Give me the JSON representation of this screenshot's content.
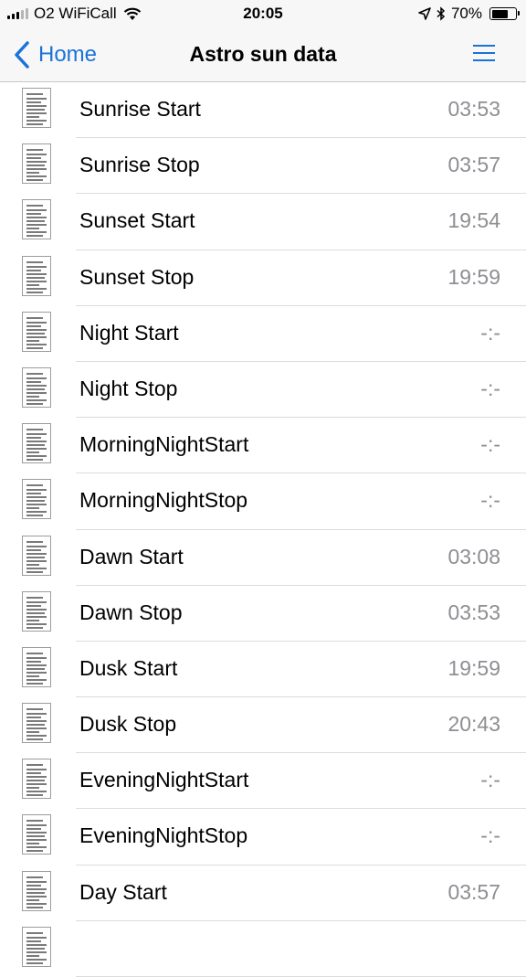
{
  "status_bar": {
    "carrier": "O2 WiFiCall",
    "time": "20:05",
    "battery_percent": "70%",
    "battery_level": 0.7,
    "icons": [
      "signal-icon",
      "wifi-icon",
      "location-arrow-icon",
      "bluetooth-icon",
      "battery-icon"
    ]
  },
  "nav": {
    "back_label": "Home",
    "title": "Astro sun data",
    "accent_color": "#1a73d9"
  },
  "rows": [
    {
      "label": "Sunrise Start",
      "value": "03:53"
    },
    {
      "label": "Sunrise Stop",
      "value": "03:57"
    },
    {
      "label": "Sunset Start",
      "value": "19:54"
    },
    {
      "label": "Sunset Stop",
      "value": "19:59"
    },
    {
      "label": "Night Start",
      "value": "-:-"
    },
    {
      "label": "Night Stop",
      "value": "-:-"
    },
    {
      "label": "MorningNightStart",
      "value": "-:-"
    },
    {
      "label": "MorningNightStop",
      "value": "-:-"
    },
    {
      "label": "Dawn Start",
      "value": "03:08"
    },
    {
      "label": "Dawn Stop",
      "value": "03:53"
    },
    {
      "label": "Dusk Start",
      "value": "19:59"
    },
    {
      "label": "Dusk Stop",
      "value": "20:43"
    },
    {
      "label": "EveningNightStart",
      "value": "-:-"
    },
    {
      "label": "EveningNightStop",
      "value": "-:-"
    },
    {
      "label": "Day Start",
      "value": "03:57"
    },
    {
      "label": "",
      "value": ""
    }
  ]
}
